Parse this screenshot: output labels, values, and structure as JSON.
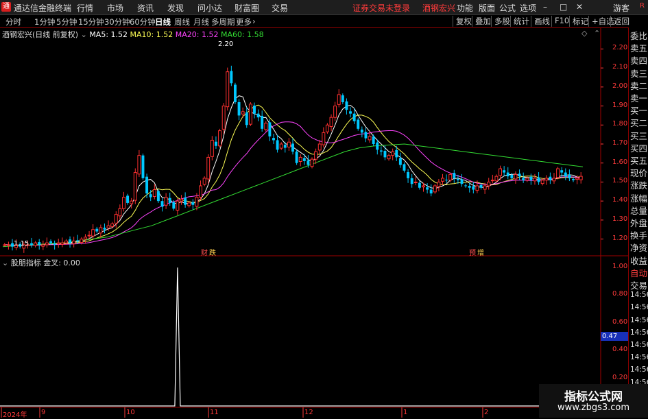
{
  "app": {
    "title": "通达信金融终端",
    "menus": [
      "行情",
      "市场",
      "资讯",
      "发现",
      "问小达",
      "财富圈",
      "交易"
    ],
    "notice": "证券交易未登录",
    "stock_name": "酒钢宏兴",
    "right_menus": [
      "功能",
      "版面",
      "公式",
      "选项"
    ],
    "guest": "游客",
    "r_label": "R"
  },
  "toolbar": {
    "periods": [
      "分时",
      "1分钟",
      "5分钟",
      "15分钟",
      "30分钟",
      "60分钟",
      "日线",
      "周线",
      "月线",
      "多周期",
      "更多"
    ],
    "active": "日线",
    "right_buttons": [
      "复权",
      "叠加",
      "多股",
      "统计",
      "画线",
      "F10",
      "标记",
      "+自选",
      "返回"
    ]
  },
  "legend": {
    "title": "酒钢宏兴(日线 前复权)",
    "ma5": "MA5: 1.52",
    "ma10": "MA10: 1.52",
    "ma20": "MA20: 1.52",
    "ma60": "MA60: 1.58"
  },
  "colors": {
    "up": "#ff3030",
    "down": "#00c8ff",
    "ma5": "#ffffff",
    "ma10": "#ffff55",
    "ma20": "#ff44ff",
    "ma60": "#33dd33",
    "axis": "#ff3b3b",
    "spike": "#ffffff"
  },
  "annotations": {
    "high": "2.20",
    "low": "1.15",
    "event1": "财",
    "event1b": "跌",
    "event2": "预",
    "event2b": "增"
  },
  "lower": {
    "title": "股朋指标  金叉: 0.00",
    "badge": "0.47",
    "axis_labels": [
      "1.00",
      "0.80",
      "0.60",
      "0.40",
      "0.20"
    ]
  },
  "price_axis_labels": [
    "2.20",
    "2.10",
    "2.00",
    "1.90",
    "1.80",
    "1.70",
    "1.60",
    "1.50",
    "1.40",
    "1.30",
    "1.20"
  ],
  "x_axis_labels": [
    "2024年",
    "9",
    "10",
    "11",
    "12",
    "1",
    "2"
  ],
  "side_panel": [
    "委比",
    "卖五",
    "卖四",
    "卖三",
    "卖二",
    "卖一",
    "买一",
    "买二",
    "买三",
    "买四",
    "买五",
    "现价",
    "涨跌",
    "涨幅",
    "总量",
    "外盘",
    "换手",
    "净资",
    "收益",
    "自动",
    "交易",
    "14:56",
    "14:56",
    "14:56",
    "14:56",
    "14:56",
    "14:56",
    "14:56",
    "14:56",
    "14:56"
  ],
  "watermark": {
    "line1": "指标公式网",
    "line2": "www.zbgs3.com"
  },
  "chart_data": {
    "type": "candlestick",
    "ylim": [
      1.13,
      2.27
    ],
    "ma_series": [
      "MA5",
      "MA10",
      "MA20",
      "MA60"
    ],
    "closes": [
      1.17,
      1.17,
      1.16,
      1.17,
      1.16,
      1.17,
      1.17,
      1.17,
      1.18,
      1.17,
      1.17,
      1.18,
      1.18,
      1.17,
      1.18,
      1.18,
      1.19,
      1.18,
      1.19,
      1.19,
      1.2,
      1.21,
      1.22,
      1.25,
      1.24,
      1.26,
      1.25,
      1.27,
      1.28,
      1.33,
      1.36,
      1.42,
      1.39,
      1.4,
      1.55,
      1.64,
      1.52,
      1.44,
      1.42,
      1.46,
      1.4,
      1.37,
      1.42,
      1.39,
      1.36,
      1.4,
      1.41,
      1.38,
      1.39,
      1.38,
      1.42,
      1.48,
      1.52,
      1.63,
      1.72,
      1.69,
      1.77,
      1.9,
      2.08,
      2.02,
      1.92,
      1.85,
      1.87,
      1.8,
      1.91,
      1.86,
      1.84,
      1.78,
      1.81,
      1.74,
      1.72,
      1.67,
      1.7,
      1.68,
      1.71,
      1.66,
      1.6,
      1.63,
      1.61,
      1.59,
      1.62,
      1.66,
      1.7,
      1.76,
      1.8,
      1.84,
      1.9,
      1.96,
      1.92,
      1.88,
      1.86,
      1.82,
      1.78,
      1.76,
      1.73,
      1.74,
      1.7,
      1.67,
      1.66,
      1.63,
      1.64,
      1.66,
      1.63,
      1.59,
      1.56,
      1.52,
      1.49,
      1.5,
      1.47,
      1.48,
      1.46,
      1.44,
      1.48,
      1.5,
      1.52,
      1.51,
      1.54,
      1.52,
      1.51,
      1.49,
      1.48,
      1.47,
      1.46,
      1.48,
      1.47,
      1.48,
      1.5,
      1.51,
      1.53,
      1.57,
      1.55,
      1.53,
      1.52,
      1.54,
      1.53,
      1.51,
      1.52,
      1.51,
      1.52,
      1.5,
      1.51,
      1.52,
      1.51,
      1.52,
      1.57,
      1.55,
      1.53,
      1.52,
      1.51,
      1.52,
      1.53
    ],
    "ma60": [
      1.16,
      1.165,
      1.17,
      1.175,
      1.18,
      1.19,
      1.2,
      1.21,
      1.23,
      1.25,
      1.27,
      1.3,
      1.33,
      1.36,
      1.39,
      1.42,
      1.45,
      1.48,
      1.51,
      1.54,
      1.57,
      1.6,
      1.63,
      1.66,
      1.68,
      1.69,
      1.695,
      1.7,
      1.69,
      1.68,
      1.67,
      1.66,
      1.65,
      1.64,
      1.63,
      1.62,
      1.61,
      1.6,
      1.59,
      1.58
    ],
    "lower_series": {
      "spike_at_index": 45,
      "spike_value": 1.0,
      "baseline": 0.0,
      "ylim": [
        0.0,
        1.05
      ]
    }
  }
}
